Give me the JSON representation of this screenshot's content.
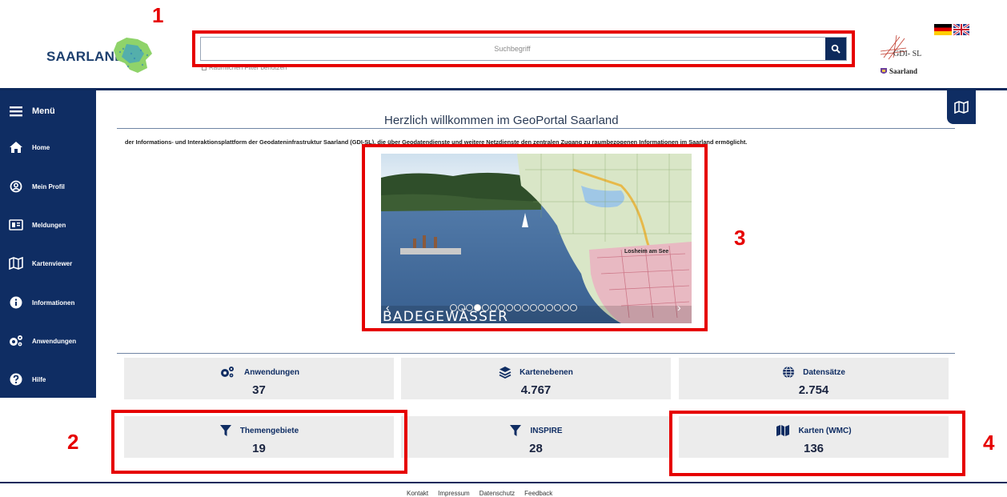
{
  "header": {
    "logo_text": "SAARLAND",
    "search": {
      "placeholder": "Suchbegriff",
      "filter_label": "Räumlichen Filter benutzen"
    },
    "gdi_text": "GDI- SL",
    "gdi_saarland": "Saarland"
  },
  "sidebar": {
    "menu_label": "Menü",
    "items": [
      {
        "label": "Home",
        "icon": "home-icon"
      },
      {
        "label": "Mein Profil",
        "icon": "user-circle-icon"
      },
      {
        "label": "Meldungen",
        "icon": "newspaper-icon"
      },
      {
        "label": "Kartenviewer",
        "icon": "map-icon"
      },
      {
        "label": "Informationen",
        "icon": "info-icon"
      },
      {
        "label": "Anwendungen",
        "icon": "cogs-icon"
      },
      {
        "label": "Hilfe",
        "icon": "question-icon"
      }
    ]
  },
  "main": {
    "title": "Herzlich willkommen im GeoPortal Saarland",
    "intro": "der Informations- und Interaktionsplattform der Geodateninfrastruktur Saarland (GDI-SL), die über Geodatendienste und weitere Netzdienste den zentralen Zugang zu raumbezogenen Informationen im Saarland ermöglicht.",
    "slider": {
      "caption": "BADEGEWÄSSER",
      "map_label": "Losheim am See",
      "dot_count": 16,
      "active_dot": 3
    },
    "stats": [
      {
        "label": "Anwendungen",
        "value": "37",
        "icon": "cogs-icon"
      },
      {
        "label": "Kartenebenen",
        "value": "4.767",
        "icon": "layers-icon"
      },
      {
        "label": "Datensätze",
        "value": "2.754",
        "icon": "globe-icon"
      },
      {
        "label": "Themengebiete",
        "value": "19",
        "icon": "filter-icon"
      },
      {
        "label": "INSPIRE",
        "value": "28",
        "icon": "filter-icon"
      },
      {
        "label": "Karten (WMC)",
        "value": "136",
        "icon": "map-icon"
      }
    ]
  },
  "footer": {
    "links": [
      "Kontakt",
      "Impressum",
      "Datenschutz",
      "Feedback"
    ]
  },
  "annotations": [
    "1",
    "2",
    "3",
    "4"
  ],
  "colors": {
    "navy": "#0f2d63",
    "annotation_red": "#e60000",
    "tile_gray": "#ececec"
  }
}
